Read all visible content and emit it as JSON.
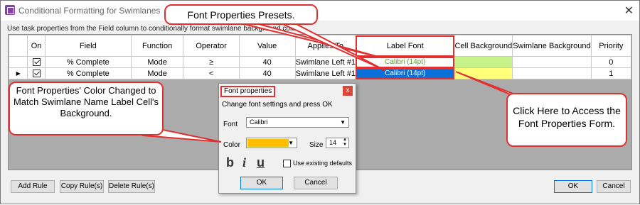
{
  "window": {
    "title": "Conditional Formatting for Swimlanes",
    "close": "✕"
  },
  "instruction": "Use task properties from the Field column to conditionally format swimlane background colors",
  "table": {
    "headers": {
      "on": "On",
      "field": "Field",
      "function": "Function",
      "operator": "Operator",
      "value": "Value",
      "applies_to": "Applies To",
      "label_font": "Label Font",
      "cell_bg": "Cell Background",
      "swimlane_bg": "Swimlane Background",
      "priority": "Priority"
    },
    "rows": [
      {
        "field": "% Complete",
        "function": "Mode",
        "operator": "≥",
        "value": "40",
        "applies_to": "Swimlane Left #1",
        "label_font": "Calibri (14pt)",
        "priority": "0"
      },
      {
        "field": "% Complete",
        "function": "Mode",
        "operator": "<",
        "value": "40",
        "applies_to": "Swimlane Left #1",
        "label_font": "Calibri (14pt)",
        "priority": "1"
      }
    ]
  },
  "colors": {
    "row1_font_color": "#5aa02c",
    "row2_font_bg": "#0a6fd6",
    "row1_cell_bg": "#c8f28a",
    "row2_cell_bg": "#ffff7a",
    "highlight": "#e03030",
    "font_color_swatch": "#ffbf00"
  },
  "buttons": {
    "add_rule": "Add Rule",
    "copy_rule": "Copy Rule(s)",
    "delete_rule": "Delete Rule(s)",
    "ok": "OK",
    "cancel": "Cancel"
  },
  "font_dialog": {
    "title": "Font properties",
    "close": "x",
    "instruction": "Change font settings and press OK",
    "font_label": "Font",
    "font_value": "Calibri",
    "color_label": "Color",
    "size_label": "Size",
    "size_value": "14",
    "bold": "b",
    "italic": "i",
    "underline": "u",
    "use_defaults": "Use existing defaults",
    "ok": "OK",
    "cancel": "Cancel"
  },
  "callouts": {
    "presets": "Font Properties Presets.",
    "color_changed": "Font Properties' Color Changed to Match Swimlane Name Label Cell's Background.",
    "click_here": "Click Here to Access the Font Properties Form."
  }
}
